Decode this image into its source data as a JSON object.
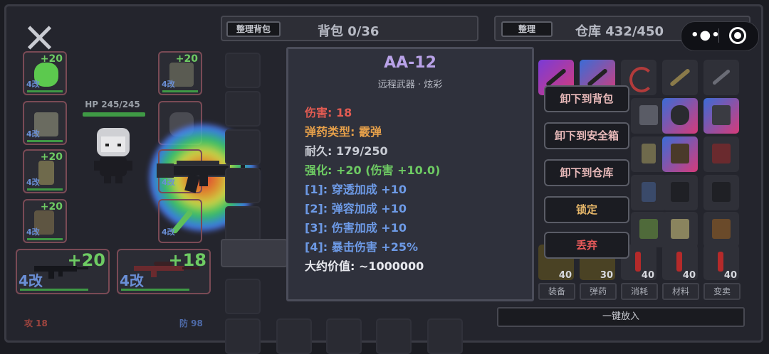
{
  "bag": {
    "sort_label": "整理背包",
    "title": "背包 0/36"
  },
  "storage": {
    "sort_label": "整理",
    "title": "仓库 432/450"
  },
  "player": {
    "hp": "HP 245/245",
    "attack": "攻 18",
    "defense": "防 98"
  },
  "equip": {
    "left": [
      {
        "plus": "+20",
        "mod": "4改",
        "icon": "slime-pet-icon",
        "color": "#5cc94e"
      },
      {
        "plus": "",
        "mod": "4改",
        "icon": "vest-icon",
        "color": "#6a6b60"
      },
      {
        "plus": "+20",
        "mod": "4改",
        "icon": "pants-icon",
        "color": "#6f6a4c"
      },
      {
        "plus": "+20",
        "mod": "4改",
        "icon": "boots-icon",
        "color": "#5e5542"
      }
    ],
    "right": [
      {
        "plus": "+20",
        "mod": "4改",
        "icon": "armor-vest-icon",
        "color": "#5a5b52"
      },
      {
        "plus": "",
        "mod": "",
        "icon": "backpack-icon",
        "color": "#4a4b52"
      },
      {
        "plus": "",
        "mod": "4改",
        "icon": "weapon-icon",
        "color": "#3a3c46"
      },
      {
        "plus": "",
        "mod": "4改",
        "icon": "green-blade-icon",
        "color": "#5fbf5a"
      }
    ],
    "weapons": [
      {
        "plus": "+20",
        "mod": "4改",
        "icon": "rifle-icon"
      },
      {
        "plus": "+18",
        "mod": "4改",
        "icon": "sniper-rifle-icon"
      }
    ]
  },
  "tooltip": {
    "name": "AA-12",
    "subtitle": "远程武器 · 炫彩",
    "lines": [
      {
        "text": "伤害: 18",
        "color": "#e25b52"
      },
      {
        "text": "弹药类型: 霰弹",
        "color": "#e6a04a"
      },
      {
        "text": "耐久: 179/250",
        "color": "#c9ccd4"
      },
      {
        "text": "强化: +20 (伤害 +10.0)",
        "color": "#6ecb63"
      },
      {
        "text": "[1]: 穿透加成 +10",
        "color": "#6d9ae6"
      },
      {
        "text": "[2]: 弹容加成 +10",
        "color": "#6d9ae6"
      },
      {
        "text": "[3]: 伤害加成 +10",
        "color": "#6d9ae6"
      },
      {
        "text": "[4]: 暴击伤害 +25%",
        "color": "#6d9ae6"
      },
      {
        "text": "大约价值: ~1000000",
        "color": "#e8e9ee"
      }
    ]
  },
  "menu": [
    "卸下到背包",
    "卸下到安全箱",
    "卸下到仓库",
    "锁定",
    "丢弃"
  ],
  "storage_items": {
    "ammo_counts": [
      "40",
      "30",
      "40",
      "40",
      "40"
    ]
  },
  "tabs": [
    "装备",
    "弹药",
    "消耗",
    "材料",
    "变卖"
  ],
  "put_all": "一键放入"
}
